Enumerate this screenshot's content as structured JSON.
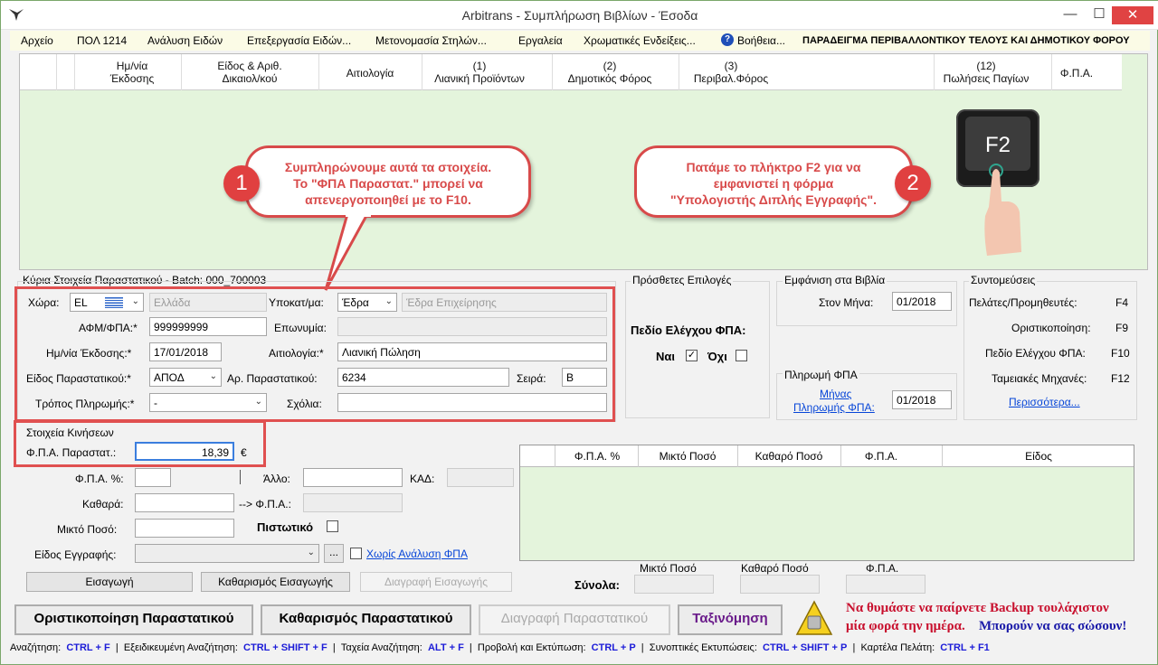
{
  "window": {
    "title": "Arbitrans - Συμπλήρωση Βιβλίων - Έσοδα",
    "minimize": "—",
    "maximize": "☐",
    "close": "✕"
  },
  "menu": {
    "items": [
      "Αρχείο",
      "ΠΟΛ 1214",
      "Ανάλυση Ειδών",
      "Επεξεργασία Ειδών...",
      "Μετονομασία Στηλών...",
      "Εργαλεία",
      "Χρωματικές Ενδείξεις...",
      "Βοήθεια..."
    ],
    "help_glyph": "?",
    "right_title": "ΠΑΡΑΔΕΙΓΜΑ ΠΕΡΙΒΑΛΛΟΝΤΙΚΟΥ ΤΕΛΟΥΣ ΚΑΙ  ΔΗΜΟΤΙΚΟΥ ΦΟΡΟΥ"
  },
  "top_grid": {
    "columns": [
      {
        "l1": "Ημ/νία",
        "l2": "Έκδοσης"
      },
      {
        "l1": "Είδος & Αριθ.",
        "l2": "Δικαιολ/κού"
      },
      {
        "l1": "Αιτιολογία",
        "l2": ""
      },
      {
        "l1": "(1)",
        "l2": "Λιανική Προϊόντων"
      },
      {
        "l1": "(2)",
        "l2": "Δημοτικός Φόρος"
      },
      {
        "l1": "(3)",
        "l2": "Περιβαλ.Φόρος"
      },
      {
        "l1": "(12)",
        "l2": "Πωλήσεις Παγίων"
      },
      {
        "l1": "Φ.Π.Α.",
        "l2": ""
      }
    ]
  },
  "callouts": {
    "one": {
      "num": "1",
      "text_l1": "Συμπληρώνουμε αυτά τα στοιχεία.",
      "text_l2": "Το \"ΦΠΑ Παραστατ.\" μπορεί να",
      "text_l3": "απενεργοποιηθεί με το F10."
    },
    "two": {
      "num": "2",
      "text_l1": "Πατάμε το πλήκτρο F2 για να",
      "text_l2": "εμφανιστεί η φόρμα",
      "text_l3": "\"Υπολογιστής Διπλής Εγγραφής\"."
    },
    "key_label": "F2"
  },
  "main_doc": {
    "legend": "Κύρια Στοιχεία Παραστατικού - Batch: 000_700003",
    "country_label": "Χώρα:",
    "country_code": "EL",
    "country_name": "Ελλάδα",
    "branch_label": "Υποκατ/μα:",
    "branch_value": "Έδρα",
    "branch_name": "Έδρα Επιχείρησης",
    "afm_label": "ΑΦΜ/ΦΠΑ:*",
    "afm_value": "999999999",
    "name_label": "Επωνυμία:",
    "name_value": "",
    "date_label": "Ημ/νία Έκδοσης:*",
    "date_value": "17/01/2018",
    "reason_label": "Αιτιολογία:*",
    "reason_value": "Λιανική Πώληση",
    "doctype_label": "Είδος Παραστατικού:*",
    "doctype_value": "ΑΠΟΔ",
    "docno_label": "Αρ. Παραστατικού:",
    "docno_value": "6234",
    "series_label": "Σειρά:",
    "series_value": "Β",
    "payment_label": "Τρόπος Πληρωμής:*",
    "payment_value": "-",
    "comments_label": "Σχόλια:",
    "comments_value": ""
  },
  "extra_options": {
    "legend": "Πρόσθετες Επιλογές",
    "vat_field_label": "Πεδίο Ελέγχου ΦΠΑ:",
    "yes_label": "Ναι",
    "no_label": "Όχι",
    "yes_checked": true,
    "no_checked": false
  },
  "books": {
    "legend": "Εμφάνιση στα Βιβλία",
    "month_label": "Στον Μήνα:",
    "month_value": "01/2018"
  },
  "vat_payment": {
    "legend": "Πληρωμή ΦΠΑ",
    "month_link_l1": "Μήνας",
    "month_link_l2": "Πληρωμής ΦΠΑ:",
    "month_value": "01/2018"
  },
  "shortcuts": {
    "legend": "Συντομεύσεις",
    "items": [
      {
        "label": "Πελάτες/Προμηθευτές:",
        "key": "F4"
      },
      {
        "label": "Οριστικοποίηση:",
        "key": "F9"
      },
      {
        "label": "Πεδίο Ελέγχου ΦΠΑ:",
        "key": "F10"
      },
      {
        "label": "Ταμειακές Μηχανές:",
        "key": "F12"
      }
    ],
    "more_link": "Περισσότερα..."
  },
  "movements": {
    "legend": "Στοιχεία Κινήσεων",
    "vat_doc_label": "Φ.Π.Α. Παραστατ.:",
    "vat_doc_value": "18,39",
    "currency": "€",
    "vat_pct_label": "Φ.Π.Α. %:",
    "other_label": "Άλλο:",
    "kad_label": "ΚΑΔ:",
    "net_label": "Καθαρά:",
    "arrow_vat_label": "--> Φ.Π.Α.:",
    "gross_label": "Μικτό Ποσό:",
    "credit_label": "Πιστωτικό",
    "entry_type_label": "Είδος Εγγραφής:",
    "ellipsis_btn": "...",
    "no_vat_analysis": "Χωρίς Ανάλυση ΦΠΑ",
    "insert_btn": "Εισαγωγή",
    "clear_insert_btn": "Καθαρισμός Εισαγωγής",
    "delete_insert_btn": "Διαγραφή Εισαγωγής"
  },
  "lines_grid": {
    "columns": [
      "Φ.Π.Α. %",
      "Μικτό Ποσό",
      "Καθαρό Ποσό",
      "Φ.Π.Α.",
      "Είδος"
    ]
  },
  "totals": {
    "label": "Σύνολα:",
    "gross": "Μικτό Ποσό",
    "net": "Καθαρό Ποσό",
    "vat": "Φ.Π.Α."
  },
  "actions": {
    "finalize": "Οριστικοποίηση Παραστατικού",
    "clear": "Καθαρισμός Παραστατικού",
    "delete": "Διαγραφή Παραστατικού",
    "sort": "Ταξινόμηση"
  },
  "backup_note": {
    "l1": "Να θυμάστε να παίρνετε Backup τουλάχιστον",
    "l2a": "μία φορά την ημέρα.",
    "l2b": "Μπορούν να σας σώσουν!"
  },
  "statusbar": [
    {
      "label": "Αναζήτηση:",
      "key": "CTRL + F"
    },
    {
      "label": "Εξειδικευμένη Αναζήτηση:",
      "key": "CTRL + SHIFT + F"
    },
    {
      "label": "Ταχεία Αναζήτηση:",
      "key": "ALT + F"
    },
    {
      "label": "Προβολή και Εκτύπωση:",
      "key": "CTRL + P"
    },
    {
      "label": "Συνοπτικές Εκτυπώσεις:",
      "key": "CTRL + SHIFT + P"
    },
    {
      "label": "Καρτέλα Πελάτη:",
      "key": "CTRL + F1"
    }
  ],
  "colors": {
    "accent_red": "#d84a4a",
    "grid_green": "#e4f4dc",
    "link_blue": "#0645d8",
    "note_red": "#c8102e",
    "note_blue": "#1a1aa8"
  }
}
